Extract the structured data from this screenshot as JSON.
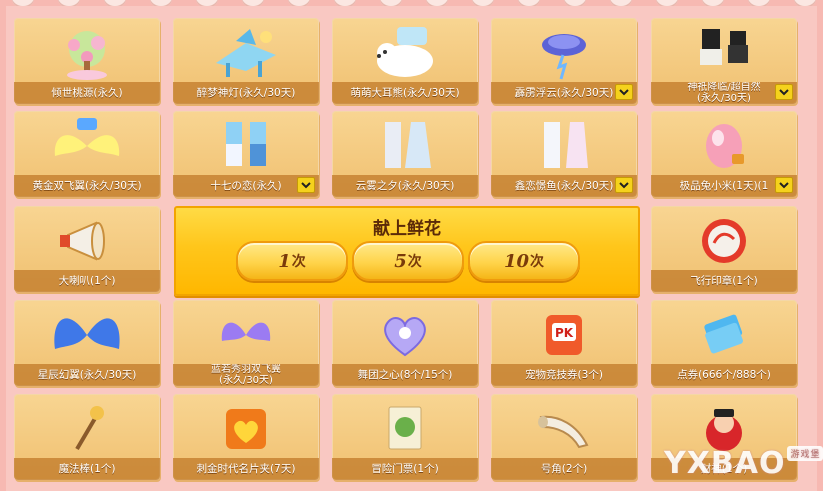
{
  "items": [
    {
      "label": "倾世桃源(永久)",
      "icon": "peach-tree-icon"
    },
    {
      "label": "醉梦神灯(永久/30天)",
      "icon": "dream-lamp-icon"
    },
    {
      "label": "萌萌大耳熊(永久/30天)",
      "icon": "polar-bear-icon"
    },
    {
      "label": "霹雳浮云(永久/30天)",
      "icon": "thunder-cloud-icon"
    },
    {
      "label": "神祇降临/超自然",
      "label2": "(永久/30天)",
      "icon": "outfit-black-icon"
    },
    {
      "label": "黄金双飞翼(永久/30天)",
      "icon": "golden-wings-icon"
    },
    {
      "label": "十七の恋(永久)",
      "icon": "couple-outfit-icon"
    },
    {
      "label": "云雾之夕(永久/30天)",
      "icon": "wedding-outfit-icon"
    },
    {
      "label": "鑫恋憬鱼(永久/30天)",
      "icon": "mermaid-outfit-icon"
    },
    {
      "label": "极品兔小米(1天)(1",
      "icon": "rabbit-egg-icon"
    },
    {
      "label": "大喇叭(1个)",
      "icon": "megaphone-icon"
    },
    {
      "label": "飞行印章(1个)",
      "icon": "flight-seal-icon"
    },
    {
      "label": "星辰幻翼(永久/30天)",
      "icon": "blue-wings-icon"
    },
    {
      "label": "蓝若秀羽双飞翼",
      "label2": "(永久/30天)",
      "icon": "purple-wings-icon"
    },
    {
      "label": "舞团之心(8个/15个)",
      "icon": "dance-heart-icon"
    },
    {
      "label": "宠物竞技券(3个)",
      "icon": "pk-ticket-icon"
    },
    {
      "label": "点券(666个/888个)",
      "icon": "coupon-icon"
    },
    {
      "label": "魔法棒(1个)",
      "icon": "magic-wand-icon"
    },
    {
      "label": "刺金时代名片夹(7天)",
      "icon": "card-holder-icon"
    },
    {
      "label": "冒险门票(1个)",
      "icon": "adventure-ticket-icon"
    },
    {
      "label": "号角(2个)",
      "icon": "horn-icon"
    },
    {
      "label": "财神(1个)",
      "icon": "fortune-god-icon"
    }
  ],
  "center": {
    "title": "献上鲜花",
    "buttons": [
      {
        "n": "1",
        "u": "次"
      },
      {
        "n": "5",
        "u": "次"
      },
      {
        "n": "10",
        "u": "次"
      }
    ]
  },
  "watermark": {
    "text": "YXBAO",
    "sub": "游戏堡"
  }
}
